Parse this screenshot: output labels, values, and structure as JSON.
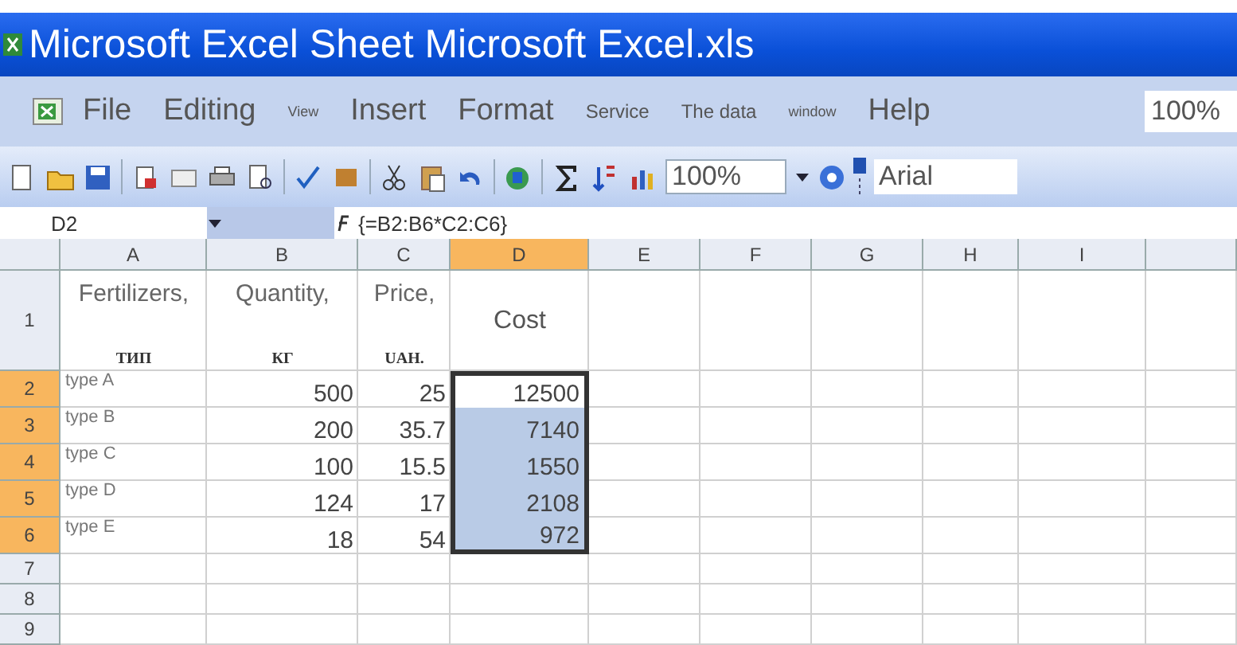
{
  "window": {
    "title": "Microsoft Excel Sheet Microsoft Excel.xls"
  },
  "menu": [
    {
      "label": "File"
    },
    {
      "label": "Editing"
    },
    {
      "label": "View"
    },
    {
      "label": "Insert"
    },
    {
      "label": "Format"
    },
    {
      "label": "Service"
    },
    {
      "label": "The data"
    },
    {
      "label": "window"
    },
    {
      "label": "Help"
    }
  ],
  "question_field": {
    "value": "100%"
  },
  "toolbar": {
    "zoom": "100%",
    "font": "Arial"
  },
  "formula_bar": {
    "name_box": "D2",
    "formula": "{=B2:B6*C2:C6}"
  },
  "sheet": {
    "columns": [
      {
        "label": "A",
        "selected": false
      },
      {
        "label": "B",
        "selected": false
      },
      {
        "label": "C",
        "selected": false
      },
      {
        "label": "D",
        "selected": true
      },
      {
        "label": "E",
        "selected": false
      },
      {
        "label": "F",
        "selected": false
      },
      {
        "label": "G",
        "selected": false
      },
      {
        "label": "H",
        "selected": false
      },
      {
        "label": "I",
        "selected": false
      }
    ],
    "rows": [
      {
        "label": "1",
        "selected": false,
        "cells": [
          {
            "text": "Fertilizers,",
            "unit": "ТИП",
            "selected": false
          },
          {
            "text": "Quantity,",
            "unit": "КГ",
            "selected": false
          },
          {
            "text": "Price,",
            "unit": "UAH.",
            "selected": false
          },
          {
            "text": "Cost",
            "selected": false
          }
        ]
      },
      {
        "label": "2",
        "selected": true,
        "cells": [
          {
            "text": "type A",
            "selected": false
          },
          {
            "text": "500",
            "selected": false
          },
          {
            "text": "25",
            "selected": false
          },
          {
            "text": "12500",
            "selected": true,
            "active": true
          }
        ]
      },
      {
        "label": "3",
        "selected": true,
        "cells": [
          {
            "text": "type B",
            "selected": false
          },
          {
            "text": "200",
            "selected": false
          },
          {
            "text": "35.7",
            "selected": false
          },
          {
            "text": "7140",
            "selected": true,
            "active": false
          }
        ]
      },
      {
        "label": "4",
        "selected": true,
        "cells": [
          {
            "text": "type C",
            "selected": false
          },
          {
            "text": "100",
            "selected": false
          },
          {
            "text": "15.5",
            "selected": false
          },
          {
            "text": "1550",
            "selected": true,
            "active": false
          }
        ]
      },
      {
        "label": "5",
        "selected": true,
        "cells": [
          {
            "text": "type D",
            "selected": false
          },
          {
            "text": "124",
            "selected": false
          },
          {
            "text": "17",
            "selected": false
          },
          {
            "text": "2108",
            "selected": true,
            "active": false
          }
        ]
      },
      {
        "label": "6",
        "selected": true,
        "cells": [
          {
            "text": "type E",
            "selected": false
          },
          {
            "text": "18",
            "selected": false
          },
          {
            "text": "54",
            "selected": false
          },
          {
            "text": "972",
            "selected": true,
            "active": false
          }
        ]
      },
      {
        "label": "7",
        "selected": false,
        "cells": []
      },
      {
        "label": "8",
        "selected": false,
        "cells": []
      },
      {
        "label": "9",
        "selected": false,
        "cells": []
      }
    ]
  }
}
